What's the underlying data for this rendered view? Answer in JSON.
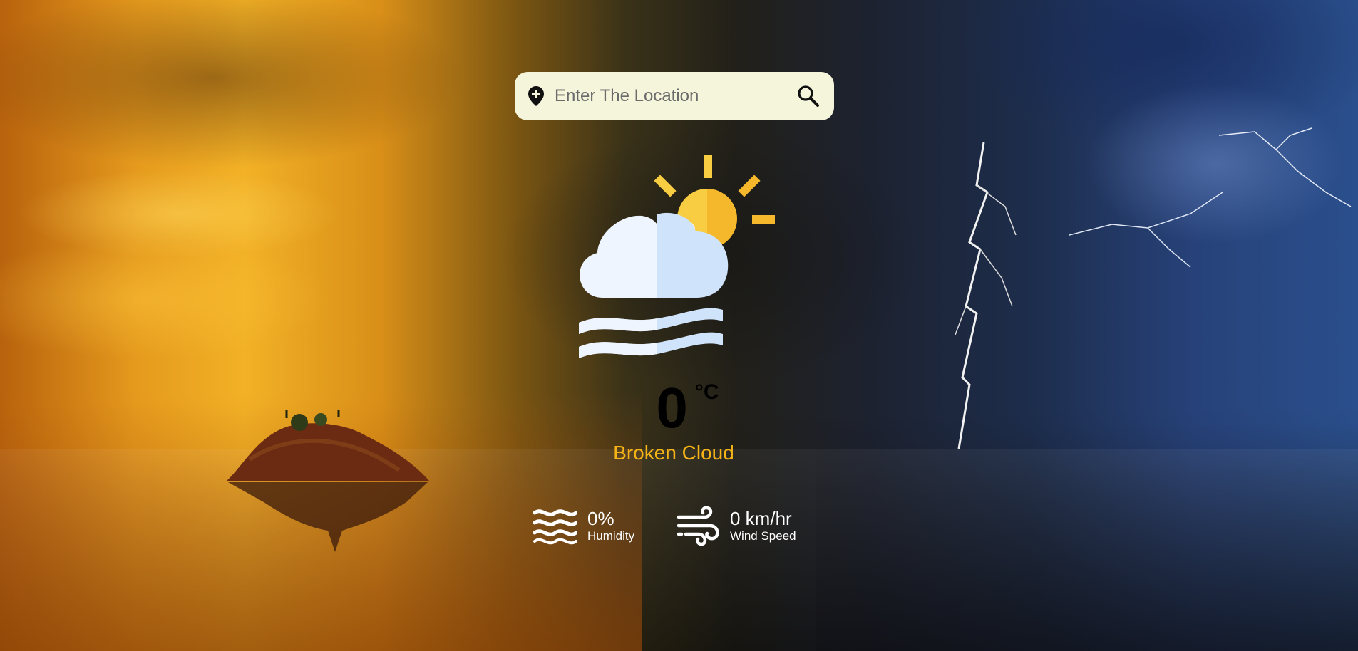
{
  "search": {
    "placeholder": "Enter The Location",
    "value": ""
  },
  "weather": {
    "temperature": "0",
    "unit": "°C",
    "description": "Broken Cloud",
    "icon": "partly-cloudy-mist-icon"
  },
  "stats": {
    "humidity": {
      "value": "0%",
      "label": "Humidity",
      "icon": "humidity-waves-icon"
    },
    "wind": {
      "value": "0 km/hr",
      "label": "Wind Speed",
      "icon": "wind-icon"
    }
  },
  "colors": {
    "search_bg": "#f5f5dc",
    "description": "#f7b417",
    "sun": "#f8c233",
    "cloud_light": "#eef5ff",
    "cloud_shade": "#cfe3fb"
  }
}
